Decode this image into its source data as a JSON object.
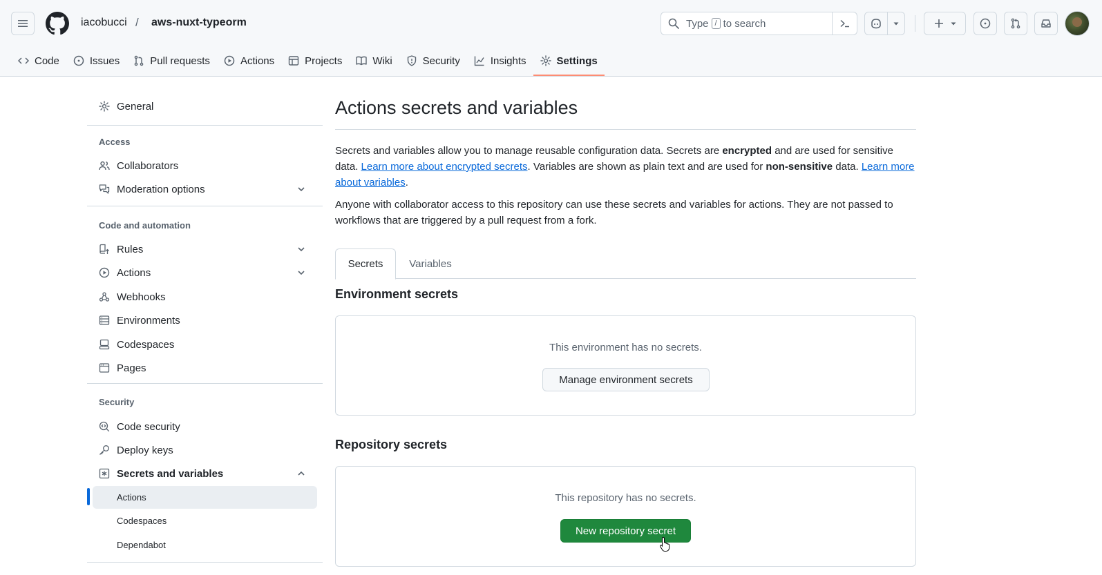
{
  "header": {
    "owner": "iacobucci",
    "separator": "/",
    "repo": "aws-nuxt-typeorm",
    "search_prefix": "Type",
    "search_key": "/",
    "search_suffix": "to search"
  },
  "repo_tabs": [
    {
      "label": "Code",
      "icon": "code-icon"
    },
    {
      "label": "Issues",
      "icon": "issue-opened-icon"
    },
    {
      "label": "Pull requests",
      "icon": "git-pull-request-icon"
    },
    {
      "label": "Actions",
      "icon": "play-icon"
    },
    {
      "label": "Projects",
      "icon": "table-icon"
    },
    {
      "label": "Wiki",
      "icon": "book-icon"
    },
    {
      "label": "Security",
      "icon": "shield-icon"
    },
    {
      "label": "Insights",
      "icon": "graph-icon"
    },
    {
      "label": "Settings",
      "icon": "gear-icon",
      "active": true
    }
  ],
  "sidebar": {
    "general": "General",
    "access_heading": "Access",
    "collaborators": "Collaborators",
    "moderation": "Moderation options",
    "code_heading": "Code and automation",
    "rules": "Rules",
    "actions": "Actions",
    "webhooks": "Webhooks",
    "environments": "Environments",
    "codespaces": "Codespaces",
    "pages": "Pages",
    "security_heading": "Security",
    "code_security": "Code security",
    "deploy_keys": "Deploy keys",
    "secrets": "Secrets and variables",
    "sub_actions": "Actions",
    "sub_codespaces": "Codespaces",
    "sub_dependabot": "Dependabot"
  },
  "main": {
    "title": "Actions secrets and variables",
    "p1_a": "Secrets and variables allow you to manage reusable configuration data. Secrets are ",
    "p1_b": "encrypted",
    "p1_c": " and are used for sensitive data. ",
    "p1_link1": "Learn more about encrypted secrets",
    "p1_d": ". Variables are shown as plain text and are used for ",
    "p1_e": "non-sensitive",
    "p1_f": " data. ",
    "p1_link2": "Learn more about variables",
    "p1_g": ".",
    "p2": "Anyone with collaborator access to this repository can use these secrets and variables for actions. They are not passed to workflows that are triggered by a pull request from a fork.",
    "tab_secrets": "Secrets",
    "tab_variables": "Variables",
    "env_title": "Environment secrets",
    "env_empty": "This environment has no secrets.",
    "env_button": "Manage environment secrets",
    "repo_title": "Repository secrets",
    "repo_empty": "This repository has no secrets.",
    "repo_button": "New repository secret"
  },
  "colors": {
    "accent": "#0969da",
    "primary_button": "#1f883d",
    "active_tab_underline": "#fd8c73"
  }
}
